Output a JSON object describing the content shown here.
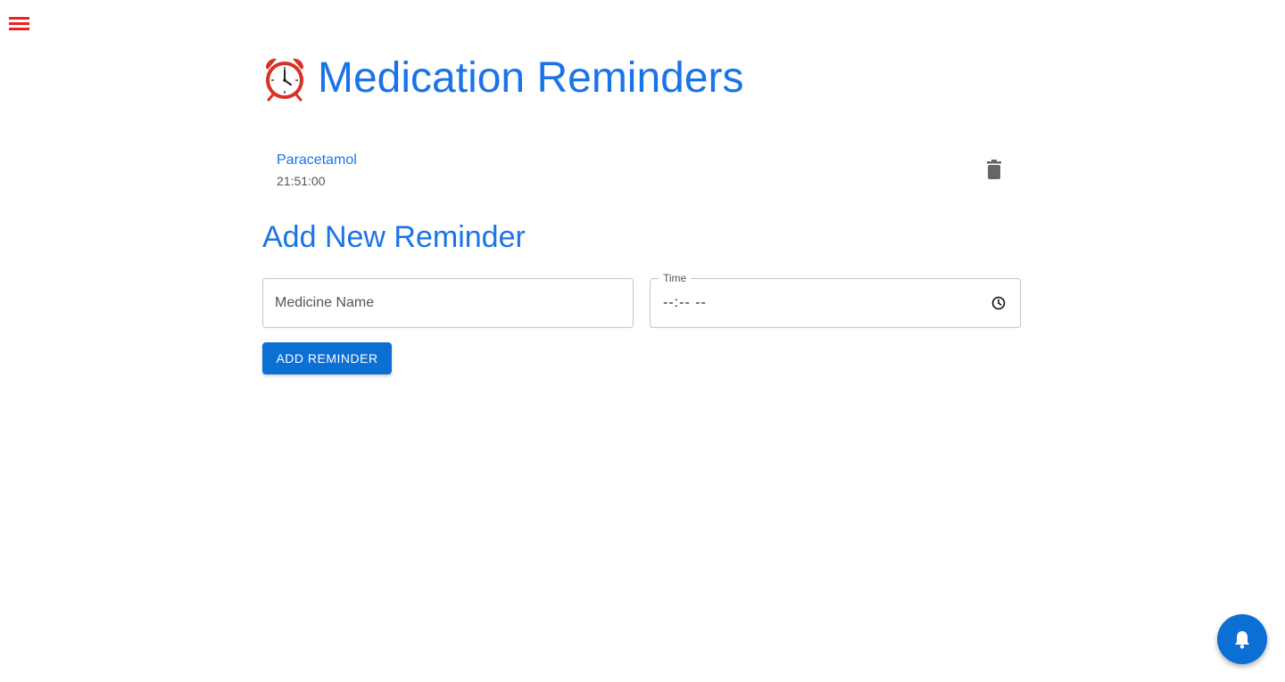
{
  "header": {
    "menu_icon": "hamburger-menu-icon",
    "title_icon": "alarm-clock-icon",
    "title": "Medication Reminders"
  },
  "reminders": [
    {
      "name": "Paracetamol",
      "time": "21:51:00",
      "delete_icon": "trash-icon"
    }
  ],
  "form": {
    "title": "Add New Reminder",
    "medicine_name_placeholder": "Medicine Name",
    "time_label": "Time",
    "time_value": "--:-- --",
    "time_icon": "clock-icon",
    "submit_label": "ADD REMINDER"
  },
  "fab": {
    "icon": "bell-icon"
  },
  "colors": {
    "primary": "#1a73e8",
    "button": "#0b6fd4",
    "menu": "#ee2222"
  }
}
